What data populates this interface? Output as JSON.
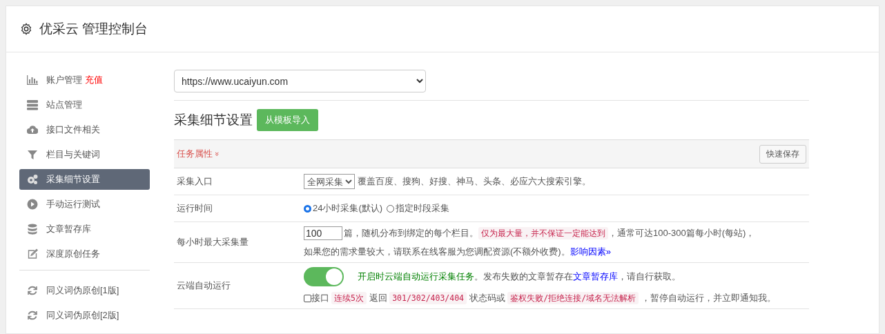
{
  "title": "优采云 管理控制台",
  "sidebar": {
    "groups": [
      [
        {
          "label": "账户管理",
          "badge": "充值",
          "selected": false
        },
        {
          "label": "站点管理",
          "selected": false
        },
        {
          "label": "接口文件相关",
          "selected": false
        },
        {
          "label": "栏目与关键词",
          "selected": false
        },
        {
          "label": "采集细节设置",
          "selected": true
        },
        {
          "label": "手动运行测试",
          "selected": false
        },
        {
          "label": "文章暂存库",
          "selected": false
        },
        {
          "label": "深度原创任务",
          "selected": false
        }
      ],
      [
        {
          "label": "同义词伪原创[1版]",
          "selected": false
        },
        {
          "label": "同义词伪原创[2版]",
          "selected": false
        }
      ]
    ]
  },
  "site_select": {
    "value": "https://www.ucaiyun.com"
  },
  "section": {
    "title": "采集细节设置",
    "import_button": "从模板导入"
  },
  "panel": {
    "title": "任务属性",
    "caret": "»",
    "save_button": "快速保存"
  },
  "rows": [
    {
      "label": "采集入口",
      "kind": "select",
      "select": "全网采集",
      "text": "覆盖百度、搜狗、好搜、神马、头条、必应六大搜索引擎。"
    },
    {
      "label": "运行时间",
      "kind": "radios",
      "options": [
        {
          "label": "24小时采集(默认)",
          "selected": true
        },
        {
          "label": "指定时段采集",
          "selected": false
        }
      ]
    },
    {
      "label": "每小时最大采集量",
      "kind": "limit",
      "value": "100",
      "lines": [
        [
          {
            "kind": "text",
            "text": "篇，随机分布到绑定的每个栏目。"
          },
          {
            "kind": "code",
            "text": "仅为最大量，并不保证一定能达到"
          },
          {
            "kind": "text",
            "text": "，通常可达100-300篇每小时(每站)，"
          }
        ],
        [
          {
            "kind": "text",
            "text": "如果您的需求量较大，请联系在线客服为您调配资源(不额外收费)。"
          },
          {
            "kind": "link",
            "text": "影响因素»"
          }
        ]
      ]
    },
    {
      "label": "云端自动运行",
      "kind": "auto",
      "on": true,
      "checked": false,
      "check_label": "接口",
      "lines": [
        [
          {
            "kind": "green",
            "text": "开启时云端自动运行采集任务"
          },
          {
            "kind": "text",
            "text": "。发布失败的文章暂存在"
          },
          {
            "kind": "link",
            "text": "文章暂存库"
          },
          {
            "kind": "text",
            "text": "，请自行获取。"
          }
        ],
        [
          {
            "kind": "code",
            "text": "连续5次"
          },
          {
            "kind": "text",
            "text": " 返回 "
          },
          {
            "kind": "code",
            "text": "301/302/403/404"
          },
          {
            "kind": "text",
            "text": " 状态码或 "
          },
          {
            "kind": "code",
            "text": "鉴权失败/拒绝连接/域名无法解析"
          },
          {
            "kind": "text",
            "text": " ，暂停自动运行，并立即通知我。"
          }
        ]
      ]
    }
  ]
}
